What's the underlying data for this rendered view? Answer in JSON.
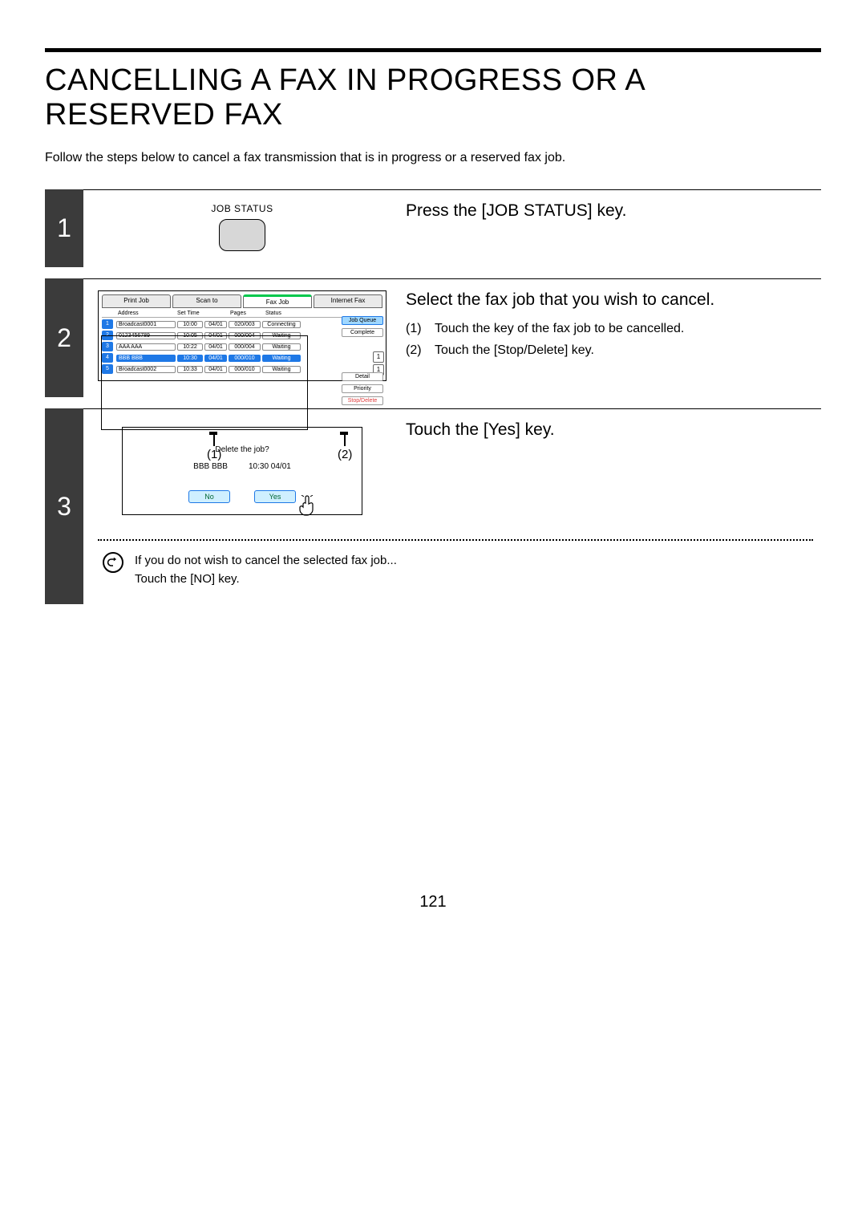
{
  "page_number": "121",
  "title": "CANCELLING A FAX IN PROGRESS OR A RESERVED FAX",
  "intro": "Follow the steps below to cancel a fax transmission that is in progress or a reserved fax job.",
  "step1": {
    "num": "1",
    "key_caption": "JOB STATUS",
    "heading": "Press the [JOB STATUS] key."
  },
  "step2": {
    "num": "2",
    "heading": "Select the fax job that you wish to cancel.",
    "sub1_n": "(1)",
    "sub1_t": "Touch the key of the fax job to be cancelled.",
    "sub2_n": "(2)",
    "sub2_t": "Touch the [Stop/Delete] key.",
    "callout1": "(1)",
    "callout2": "(2)",
    "tabs": {
      "print": "Print Job",
      "scan": "Scan to",
      "fax": "Fax Job",
      "ifax": "Internet Fax"
    },
    "headers": {
      "addr": "Address",
      "time": "Set Time",
      "pages": "Pages",
      "status": "Status"
    },
    "spin": {
      "up": "1",
      "down": "1"
    },
    "side": {
      "queue": "Job Queue",
      "complete": "Complete",
      "detail": "Detail",
      "priority": "Priority",
      "stop": "Stop/Delete"
    },
    "rows": [
      {
        "idx": "1",
        "addr": "Broadcast0001",
        "t": "10:00",
        "d": "04/01",
        "pg": "020/003",
        "st": "Connecting",
        "sel": false
      },
      {
        "idx": "2",
        "addr": "0123456789",
        "t": "10:05",
        "d": "04/01",
        "pg": "000/004",
        "st": "Waiting",
        "sel": false
      },
      {
        "idx": "3",
        "addr": "AAA AAA",
        "t": "10:22",
        "d": "04/01",
        "pg": "000/004",
        "st": "Waiting",
        "sel": false
      },
      {
        "idx": "4",
        "addr": "BBB BBB",
        "t": "10:30",
        "d": "04/01",
        "pg": "000/010",
        "st": "Waiting",
        "sel": true
      },
      {
        "idx": "5",
        "addr": "Broadcast0002",
        "t": "10:33",
        "d": "04/01",
        "pg": "000/010",
        "st": "Waiting",
        "sel": false
      }
    ]
  },
  "step3": {
    "num": "3",
    "heading": "Touch the [Yes] key.",
    "dlg_q": "Delete the job?",
    "dlg_name": "BBB BBB",
    "dlg_time": "10:30 04/01",
    "no": "No",
    "yes": "Yes",
    "note1": "If you do not wish to cancel the selected fax job...",
    "note2": "Touch the [NO] key."
  }
}
